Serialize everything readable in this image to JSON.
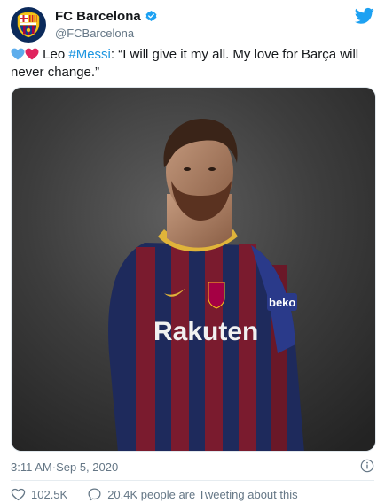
{
  "account": {
    "display_name": "FC Barcelona",
    "handle": "@FCBarcelona",
    "avatar_icon": "fc-barcelona-crest-icon",
    "verified_icon": "verified-badge-icon",
    "brand_icon": "twitter-bird-icon"
  },
  "tweet": {
    "emoji_1": "blue-heart-icon",
    "emoji_2": "red-heart-icon",
    "prefix": "Leo ",
    "hashtag": "#Messi",
    "suffix": ": “I will give it my all. My love for Barça will never change.”",
    "media_description_icon": "photo-icon"
  },
  "meta": {
    "time": "3:11 AM",
    "separator": " · ",
    "date": "Sep 5, 2020",
    "info_icon": "info-icon"
  },
  "actions": {
    "likes": "102.5K",
    "conversation": "20.4K people are Tweeting about this"
  },
  "colors": {
    "link": "#1b95e0",
    "twitter_blue": "#1da1f2",
    "secondary_text": "#657786",
    "heart_red": "#e0245e",
    "heart_blue": "#5dadec"
  }
}
